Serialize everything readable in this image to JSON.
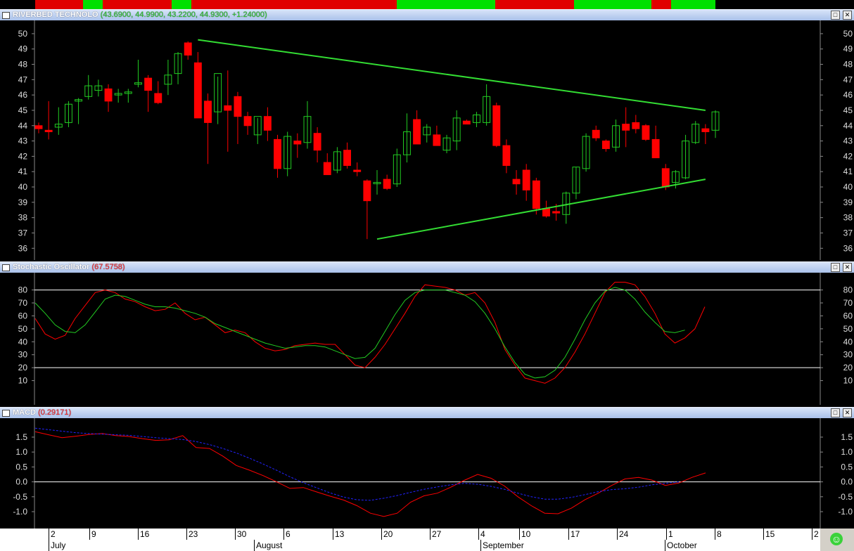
{
  "price_panel": {
    "symbol": "RIVERBED TECHNOLO",
    "values": "(43.6900, 44.9900, 43.2200, 44.9300, +1.24000)",
    "y_ticks": [
      "50",
      "49",
      "48",
      "47",
      "46",
      "45",
      "44",
      "43",
      "42",
      "41",
      "40",
      "39",
      "38",
      "37",
      "36"
    ]
  },
  "stoch_panel": {
    "name": "Stochastic Oscillator",
    "value": "(67.5758)",
    "y_ticks": [
      "80",
      "70",
      "60",
      "50",
      "40",
      "30",
      "20",
      "10"
    ]
  },
  "macd_panel": {
    "name": "MACD",
    "value": "(0.29171)",
    "y_ticks": [
      "1.5",
      "1.0",
      "0.5",
      "0.0",
      "-0.5",
      "-1.0"
    ]
  },
  "date_axis": {
    "days": [
      "2",
      "9",
      "16",
      "23",
      "30",
      "6",
      "13",
      "20",
      "27",
      "4",
      "10",
      "17",
      "24",
      "1",
      "8",
      "15",
      "2"
    ],
    "months": [
      "July",
      "August",
      "September",
      "October"
    ]
  },
  "colors": {
    "up": "#22cc22",
    "down": "#ff0000",
    "trend": "#33dd33",
    "signal": "#2222ff"
  },
  "chart_data": [
    {
      "type": "candlestick",
      "title": "RIVERBED TECHNOLO",
      "ylim": [
        35.6,
        50.5
      ],
      "candles": [
        [
          44,
          44.2,
          43.5,
          43.8
        ],
        [
          43.7,
          45.6,
          43.1,
          43.6
        ],
        [
          43.9,
          45.2,
          43.4,
          44.1
        ],
        [
          44.2,
          45.6,
          43.9,
          45.4
        ],
        [
          45.6,
          45.8,
          44.1,
          45.7
        ],
        [
          45.9,
          47.3,
          45.7,
          46.6
        ],
        [
          46.3,
          47.0,
          45.9,
          46.6
        ],
        [
          46.4,
          46.7,
          44.9,
          45.6
        ],
        [
          46.0,
          46.4,
          45.5,
          46.1
        ],
        [
          46.1,
          46.4,
          45.5,
          46.2
        ],
        [
          46.7,
          48.3,
          46.5,
          46.8
        ],
        [
          47.1,
          47.3,
          44.9,
          46.3
        ],
        [
          46.1,
          46.9,
          45.4,
          45.5
        ],
        [
          46.7,
          48.3,
          46.0,
          47.3
        ],
        [
          47.4,
          48.8,
          46.7,
          48.7
        ],
        [
          49.4,
          49.5,
          48.3,
          48.6
        ],
        [
          48.1,
          48.8,
          44.6,
          44.5
        ],
        [
          45.6,
          46.1,
          41.5,
          44.2
        ],
        [
          44.9,
          47.2,
          44.1,
          47.4
        ],
        [
          45.3,
          47.6,
          42.3,
          45.0
        ],
        [
          45.9,
          46.2,
          42.8,
          44.6
        ],
        [
          44.6,
          44.9,
          43.4,
          44.0
        ],
        [
          43.4,
          44.5,
          42.8,
          44.6
        ],
        [
          44.6,
          45.2,
          43.0,
          43.7
        ],
        [
          43.1,
          43.4,
          40.6,
          41.2
        ],
        [
          41.2,
          43.6,
          40.7,
          43.3
        ],
        [
          43.0,
          43.5,
          41.9,
          42.8
        ],
        [
          42.9,
          45.6,
          42.5,
          44.6
        ],
        [
          43.5,
          43.9,
          41.6,
          42.4
        ],
        [
          41.6,
          42.2,
          40.9,
          40.8
        ],
        [
          41.1,
          42.6,
          40.9,
          42.3
        ],
        [
          42.4,
          42.9,
          41.2,
          41.4
        ],
        [
          41.1,
          41.6,
          40.7,
          41.0
        ],
        [
          40.4,
          40.5,
          36.6,
          39.1
        ],
        [
          40.3,
          41.1,
          39.5,
          40.3
        ],
        [
          40.5,
          40.8,
          39.8,
          39.9
        ],
        [
          40.2,
          42.5,
          40.0,
          42.1
        ],
        [
          42.1,
          44.8,
          41.6,
          43.6
        ],
        [
          44.4,
          45.0,
          42.8,
          42.8
        ],
        [
          43.4,
          44.1,
          42.9,
          43.9
        ],
        [
          43.4,
          44.0,
          42.7,
          42.7
        ],
        [
          42.4,
          43.4,
          42.2,
          43.2
        ],
        [
          43.0,
          45.0,
          42.4,
          44.5
        ],
        [
          44.3,
          44.4,
          44.1,
          44.1
        ],
        [
          44.2,
          44.9,
          43.9,
          44.7
        ],
        [
          44.2,
          46.7,
          44.0,
          45.9
        ],
        [
          45.3,
          45.5,
          42.6,
          42.7
        ],
        [
          42.7,
          43.1,
          40.9,
          41.4
        ],
        [
          40.5,
          41.1,
          39.5,
          40.2
        ],
        [
          41.1,
          41.5,
          39.1,
          39.8
        ],
        [
          40.4,
          40.6,
          38.2,
          38.6
        ],
        [
          38.6,
          39.1,
          38.0,
          38.1
        ],
        [
          38.4,
          38.9,
          37.8,
          38.3
        ],
        [
          38.2,
          39.7,
          37.6,
          39.6
        ],
        [
          39.6,
          41.3,
          39.2,
          41.3
        ],
        [
          41.2,
          43.5,
          41.0,
          43.3
        ],
        [
          43.7,
          44.0,
          43.0,
          43.2
        ],
        [
          43.0,
          43.1,
          42.3,
          42.5
        ],
        [
          42.6,
          44.4,
          42.3,
          44.0
        ],
        [
          44.1,
          45.2,
          42.6,
          43.7
        ],
        [
          44.2,
          44.7,
          43.5,
          43.8
        ],
        [
          44.0,
          44.1,
          43.0,
          43.1
        ],
        [
          43.1,
          44.0,
          42.2,
          41.9
        ],
        [
          41.2,
          41.5,
          39.8,
          40.0
        ],
        [
          40.3,
          41.1,
          39.9,
          41.0
        ],
        [
          40.6,
          43.4,
          40.5,
          43.0
        ],
        [
          42.9,
          44.3,
          42.8,
          44.1
        ],
        [
          43.8,
          44.1,
          42.8,
          43.6
        ],
        [
          43.7,
          45.0,
          43.2,
          44.9
        ]
      ],
      "trendlines": [
        [
          [
            16,
            49.6
          ],
          [
            67,
            45.0
          ]
        ],
        [
          [
            34,
            36.6
          ],
          [
            67,
            40.5
          ]
        ]
      ]
    },
    {
      "type": "line",
      "title": "Stochastic Oscillator",
      "ylim": [
        0,
        89
      ],
      "hlines": [
        80,
        20
      ],
      "series": [
        {
          "color": "#ff0000",
          "values": [
            58,
            46,
            42,
            45,
            58,
            68,
            78,
            80,
            78,
            73,
            71,
            67,
            64,
            65,
            70,
            62,
            57,
            59,
            53,
            47,
            49,
            47,
            40,
            35,
            33,
            34,
            37,
            38,
            39,
            38,
            38,
            30,
            22,
            20,
            28,
            38,
            50,
            62,
            75,
            84,
            83,
            82,
            80,
            76,
            78,
            70,
            55,
            34,
            22,
            12,
            10,
            8,
            12,
            20,
            32,
            46,
            62,
            78,
            86,
            86,
            84,
            75,
            62,
            46,
            39,
            43,
            50,
            67
          ]
        },
        {
          "color": "#22cc22",
          "values": [
            70,
            62,
            53,
            48,
            47,
            53,
            63,
            73,
            76,
            75,
            72,
            69,
            67,
            67,
            66,
            64,
            62,
            59,
            54,
            51,
            48,
            45,
            42,
            39,
            37,
            35,
            36,
            37,
            37,
            36,
            33,
            30,
            27,
            28,
            35,
            48,
            61,
            72,
            78,
            80,
            80,
            80,
            78,
            76,
            71,
            62,
            50,
            36,
            24,
            15,
            12,
            13,
            18,
            28,
            42,
            57,
            70,
            79,
            82,
            80,
            73,
            63,
            55,
            48,
            47,
            49
          ]
        }
      ]
    },
    {
      "type": "line",
      "title": "MACD",
      "ylim": [
        -1.4,
        1.9
      ],
      "hlines": [
        0
      ],
      "series": [
        {
          "color": "#ff0000",
          "values": [
            1.68,
            1.58,
            1.48,
            1.53,
            1.59,
            1.62,
            1.55,
            1.52,
            1.45,
            1.39,
            1.41,
            1.55,
            1.15,
            1.12,
            0.86,
            0.55,
            0.39,
            0.21,
            0.0,
            -0.22,
            -0.19,
            -0.34,
            -0.48,
            -0.61,
            -0.8,
            -1.05,
            -1.16,
            -1.05,
            -0.68,
            -0.47,
            -0.38,
            -0.18,
            0.05,
            0.25,
            0.12,
            -0.14,
            -0.5,
            -0.8,
            -1.05,
            -1.07,
            -0.88,
            -0.6,
            -0.38,
            -0.12,
            0.1,
            0.15,
            0.06,
            -0.12,
            -0.04,
            0.15,
            0.3
          ]
        },
        {
          "color": "#2222ff",
          "values": [
            1.8,
            1.75,
            1.7,
            1.65,
            1.62,
            1.6,
            1.58,
            1.56,
            1.52,
            1.48,
            1.45,
            1.42,
            1.35,
            1.25,
            1.12,
            0.97,
            0.79,
            0.6,
            0.39,
            0.17,
            -0.03,
            -0.2,
            -0.37,
            -0.51,
            -0.6,
            -0.62,
            -0.55,
            -0.46,
            -0.35,
            -0.25,
            -0.17,
            -0.1,
            -0.05,
            -0.08,
            -0.15,
            -0.25,
            -0.38,
            -0.5,
            -0.58,
            -0.58,
            -0.52,
            -0.43,
            -0.33,
            -0.26,
            -0.23,
            -0.18,
            -0.1,
            -0.05,
            0.0
          ]
        }
      ]
    }
  ]
}
